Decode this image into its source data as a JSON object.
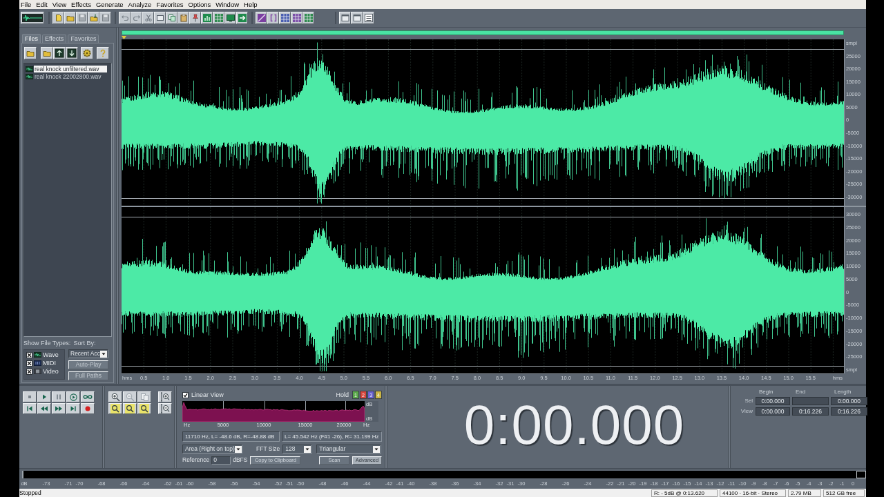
{
  "menu": [
    "File",
    "Edit",
    "View",
    "Effects",
    "Generate",
    "Analyze",
    "Favorites",
    "Options",
    "Window",
    "Help"
  ],
  "sidebar": {
    "tabs": [
      {
        "label": "Files",
        "selected": true
      },
      {
        "label": "Effects",
        "selected": false
      },
      {
        "label": "Favorites",
        "selected": false
      }
    ],
    "files": [
      {
        "name": "real knock unfiltered.wav",
        "selected": true
      },
      {
        "name": "real knock 22002800.wav",
        "selected": false
      }
    ],
    "show_file_types_label": "Show File Types:",
    "file_types": [
      {
        "label": "Wave",
        "kind": "wave",
        "checked": true
      },
      {
        "label": "MIDI",
        "kind": "midi",
        "checked": true
      },
      {
        "label": "Video",
        "kind": "video",
        "checked": true
      }
    ],
    "sort_by_label": "Sort By:",
    "sort_by": "Recent Acc",
    "buttons": [
      "Auto-Play",
      "Full Paths"
    ]
  },
  "waveform": {
    "channels": [
      {
        "scale": [
          "smpl",
          "25000",
          "20000",
          "15000",
          "10000",
          "5000",
          "0",
          "-5000",
          "-10000",
          "-15000",
          "-20000",
          "-25000",
          "-30000"
        ]
      },
      {
        "scale": [
          "30000",
          "25000",
          "20000",
          "15000",
          "10000",
          "5000",
          "0",
          "-5000",
          "-10000",
          "-15000",
          "-20000",
          "-25000",
          "smpl"
        ]
      }
    ],
    "time_ruler": [
      "hms",
      "0.5",
      "1.0",
      "1.5",
      "2.0",
      "2.5",
      "3.0",
      "3.5",
      "4.0",
      "4.5",
      "5.0",
      "5.5",
      "6.0",
      "6.5",
      "7.0",
      "7.5",
      "8.0",
      "8.5",
      "9.0",
      "9.5",
      "10.0",
      "10.5",
      "11.0",
      "11.5",
      "12.0",
      "12.5",
      "13.0",
      "13.5",
      "14.0",
      "14.5",
      "15.0",
      "15.5",
      "hms"
    ]
  },
  "spectrum": {
    "linear_view": {
      "label": "Linear View",
      "checked": true
    },
    "hold_label": "Hold",
    "hold_buttons": [
      {
        "label": "1",
        "color": "#5aa84a"
      },
      {
        "label": "2",
        "color": "#d8453c"
      },
      {
        "label": "3",
        "color": "#6a62d0"
      },
      {
        "label": "4",
        "color": "#c9b443"
      }
    ],
    "y_labels": [
      "dB",
      "dB"
    ],
    "x_labels": [
      "Hz",
      "5000",
      "10000",
      "15000",
      "20000",
      "Hz"
    ],
    "readouts": [
      "11710 Hz, L= -48.6 dB, R=-48.88 dB",
      "L= 45.542 Hz (F#1 -26), R= 31.199 Hz"
    ],
    "display_mode": "Area (Right on top)",
    "fft_size_label": "FFT Size",
    "fft_size": "128",
    "window": "Triangular",
    "reference_label": "Reference",
    "reference": "0",
    "reference_unit": "dBFS",
    "buttons": [
      "Copy to Clipboard",
      "Scan",
      "Advanced"
    ]
  },
  "time_display": "0:00.000",
  "range": {
    "columns": [
      "Begin",
      "End",
      "Length"
    ],
    "rows": [
      {
        "label": "Sel",
        "begin": "0:00.000",
        "length": "0:00.000"
      },
      {
        "label": "View",
        "begin": "0:00.000",
        "end": "0:16.226",
        "length": "0:16.226"
      }
    ]
  },
  "level_meter": {
    "scale": [
      "dB",
      "-73",
      "-71",
      "-70",
      "-68",
      "-66",
      "-64",
      "-62",
      "-61",
      "-60",
      "-58",
      "-56",
      "-54",
      "-52",
      "-51",
      "-50",
      "-48",
      "-46",
      "-44",
      "-42",
      "-41",
      "-40",
      "-38",
      "-36",
      "-34",
      "-32",
      "-31",
      "-30",
      "-28",
      "-26",
      "-24",
      "-22",
      "-21",
      "-20",
      "-19",
      "-18",
      "-17",
      "-16",
      "-15",
      "-14",
      "-13",
      "-12",
      "-11",
      "-10",
      "-9",
      "-8",
      "-7",
      "-6",
      "-5",
      "-4",
      "-3",
      "-2",
      "-1",
      "0"
    ]
  },
  "status_bar": {
    "state": "Stopped",
    "cells": [
      "R: - 5dB @ 0:13.620",
      "44100 · 16-bit · Stereo",
      "2.79 MB",
      "512 GB free"
    ]
  }
}
